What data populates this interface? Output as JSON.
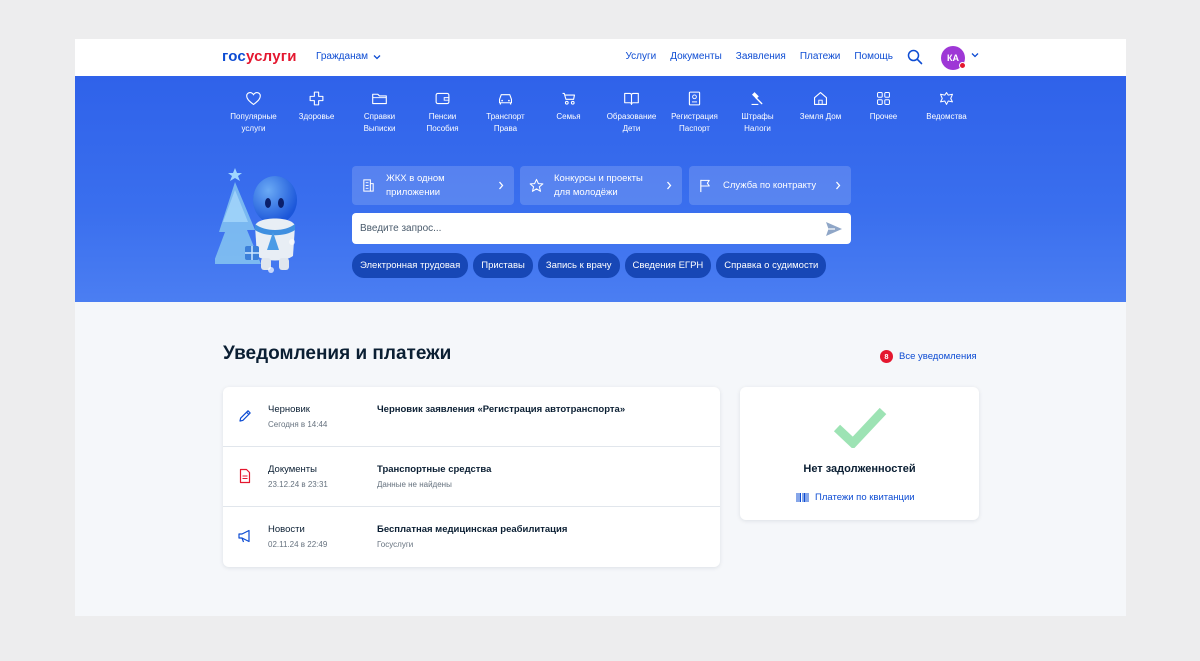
{
  "header": {
    "logo_part1": "гос",
    "logo_part2": "услуги",
    "role_label": "Гражданам",
    "nav": [
      "Услуги",
      "Документы",
      "Заявления",
      "Платежи",
      "Помощь"
    ],
    "avatar_initials": "КА"
  },
  "categories": [
    {
      "icon": "heart-icon",
      "line1": "Популярные",
      "line2": "услуги"
    },
    {
      "icon": "cross-icon",
      "line1": "Здоровье",
      "line2": ""
    },
    {
      "icon": "folder-icon",
      "line1": "Справки",
      "line2": "Выписки"
    },
    {
      "icon": "wallet-icon",
      "line1": "Пенсии",
      "line2": "Пособия"
    },
    {
      "icon": "car-icon",
      "line1": "Транспорт",
      "line2": "Права"
    },
    {
      "icon": "stroller-icon",
      "line1": "Семья",
      "line2": ""
    },
    {
      "icon": "book-icon",
      "line1": "Образование",
      "line2": "Дети"
    },
    {
      "icon": "passport-icon",
      "line1": "Регистрация",
      "line2": "Паспорт"
    },
    {
      "icon": "gavel-icon",
      "line1": "Штрафы",
      "line2": "Налоги"
    },
    {
      "icon": "house-icon",
      "line1": "Земля Дом",
      "line2": ""
    },
    {
      "icon": "grid-icon",
      "line1": "Прочее",
      "line2": ""
    },
    {
      "icon": "emblem-icon",
      "line1": "Ведомства",
      "line2": ""
    }
  ],
  "quick_links": [
    {
      "icon": "building-icon",
      "line1": "ЖКХ в одном",
      "line2": "приложении"
    },
    {
      "icon": "star-icon",
      "line1": "Конкурсы и проекты",
      "line2": "для молодёжи"
    },
    {
      "icon": "flag-icon",
      "line1": "Служба по контракту",
      "line2": ""
    }
  ],
  "search": {
    "placeholder": "Введите запрос..."
  },
  "chips": [
    "Электронная трудовая",
    "Приставы",
    "Запись к врачу",
    "Сведения ЕГРН",
    "Справка о судимости"
  ],
  "notifications": {
    "title": "Уведомления и платежи",
    "badge_count": "8",
    "all_link": "Все уведомления",
    "items": [
      {
        "icon": "pencil-icon",
        "type": "Черновик",
        "date": "Сегодня в 14:44",
        "title": "Черновик заявления «Регистрация автотранспорта»",
        "subtitle": ""
      },
      {
        "icon": "document-icon",
        "type": "Документы",
        "date": "23.12.24 в 23:31",
        "title": "Транспортные средства",
        "subtitle": "Данные не найдены"
      },
      {
        "icon": "megaphone-icon",
        "type": "Новости",
        "date": "02.11.24 в 22:49",
        "title": "Бесплатная медицинская реабилитация",
        "subtitle": "Госуслуги"
      }
    ]
  },
  "debt": {
    "title": "Нет задолженностей",
    "link": "Платежи по квитанции"
  },
  "colors": {
    "brand_blue": "#0d4cd3",
    "brand_red": "#e4172f",
    "hero_blue": "#3a6fee",
    "chip_blue": "#1747b6",
    "check_green": "#9de3b4",
    "avatar_purple": "#9e37d6"
  }
}
